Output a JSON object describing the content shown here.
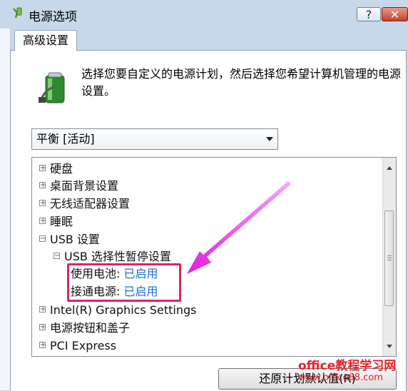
{
  "window": {
    "title": "电源选项",
    "help_label": "?",
    "close_label": "✕"
  },
  "tab": {
    "label": "高级设置"
  },
  "description": "选择您要自定义的电源计划，然后选择您希望计算机管理的电源设置。",
  "plan_select": {
    "value": "平衡 [活动]"
  },
  "tree": {
    "items": [
      {
        "label": "硬盘",
        "expander": "⊞"
      },
      {
        "label": "桌面背景设置",
        "expander": "⊞"
      },
      {
        "label": "无线适配器设置",
        "expander": "⊞"
      },
      {
        "label": "睡眠",
        "expander": "⊞"
      },
      {
        "label": "USB 设置",
        "expander": "⊟"
      },
      {
        "label": "USB 选择性暂停设置",
        "expander": "⊟"
      },
      {
        "label": "使用电池:",
        "value": "已启用"
      },
      {
        "label": "接通电源:",
        "value": "已启用"
      },
      {
        "label": "Intel(R) Graphics Settings",
        "expander": "⊞"
      },
      {
        "label": "电源按钮和盖子",
        "expander": "⊞"
      },
      {
        "label": "PCI Express",
        "expander": "⊞"
      }
    ]
  },
  "restore_button": {
    "label": "还原计划默认值(R)"
  },
  "watermark": {
    "text": "office教程学习网",
    "url": "www.office68.com"
  },
  "colors": {
    "highlight": "#e4225c",
    "arrow": "#e020e0",
    "link_value": "#1a6fd1"
  }
}
